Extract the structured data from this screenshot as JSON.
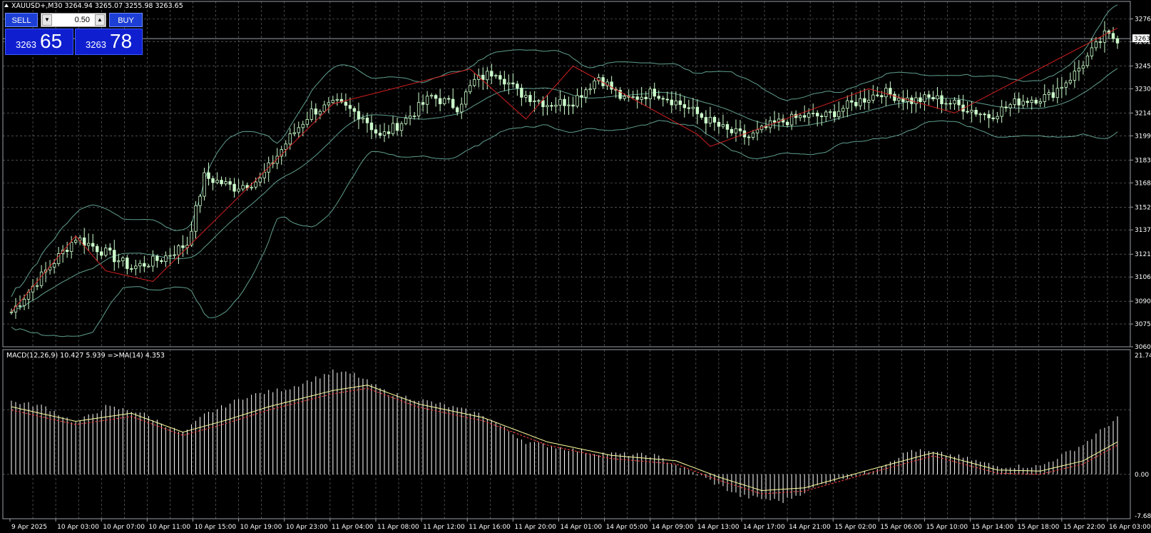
{
  "header": {
    "symbol_line": "XAUUSD+,M30  3264.94 3265.07 3255.98 3263.65"
  },
  "trade_panel": {
    "sell_label": "SELL",
    "buy_label": "BUY",
    "lot_value": "0.50",
    "sell_price_prefix": "3263",
    "sell_price_big": "65",
    "buy_price_prefix": "3263",
    "buy_price_big": "78"
  },
  "colors": {
    "background": "#000000",
    "grid": "#9aa0a6",
    "bull_candle": "#ccffcc",
    "bear_candle": "#ccffcc",
    "bands": "#5f9f8f",
    "zigzag": "#d42020",
    "macd_hist": "#ffffff",
    "macd_signal": "#ffffa0",
    "macd_ma": "#ff4040",
    "price_line": "#9aa0a6"
  },
  "price_axis": {
    "ticks": [
      "3276",
      "3261",
      "3245",
      "3230",
      "3214",
      "3199",
      "3183",
      "3168",
      "3152",
      "3137",
      "3121",
      "3106",
      "3090",
      "3075",
      "3060"
    ],
    "current_price": "3263"
  },
  "macd_panel": {
    "title": "MACD(12,26,9) 10.427 5.939  =>MA(14) 4.353",
    "ticks": [
      "21.74",
      "0.00",
      "-7.68"
    ]
  },
  "time_axis": {
    "labels": [
      "9 Apr 2025",
      "10 Apr 03:00",
      "10 Apr 07:00",
      "10 Apr 11:00",
      "10 Apr 15:00",
      "10 Apr 19:00",
      "10 Apr 23:00",
      "11 Apr 04:00",
      "11 Apr 08:00",
      "11 Apr 12:00",
      "11 Apr 16:00",
      "11 Apr 20:00",
      "14 Apr 01:00",
      "14 Apr 05:00",
      "14 Apr 09:00",
      "14 Apr 13:00",
      "14 Apr 17:00",
      "14 Apr 21:00",
      "15 Apr 02:00",
      "15 Apr 06:00",
      "15 Apr 10:00",
      "15 Apr 14:00",
      "15 Apr 18:00",
      "15 Apr 22:00",
      "16 Apr 03:00"
    ]
  },
  "chart_data": {
    "type": "candlestick",
    "symbol": "XAUUSD+",
    "timeframe": "M30",
    "ylim": [
      3060,
      3280
    ],
    "close_anchors": [
      [
        0,
        3083
      ],
      [
        8,
        3110
      ],
      [
        15,
        3132
      ],
      [
        22,
        3122
      ],
      [
        28,
        3112
      ],
      [
        35,
        3118
      ],
      [
        41,
        3128
      ],
      [
        45,
        3172
      ],
      [
        52,
        3165
      ],
      [
        58,
        3170
      ],
      [
        65,
        3198
      ],
      [
        70,
        3215
      ],
      [
        76,
        3220
      ],
      [
        82,
        3212
      ],
      [
        86,
        3198
      ],
      [
        92,
        3210
      ],
      [
        98,
        3225
      ],
      [
        104,
        3218
      ],
      [
        108,
        3235
      ],
      [
        113,
        3242
      ],
      [
        118,
        3228
      ],
      [
        125,
        3220
      ],
      [
        131,
        3222
      ],
      [
        137,
        3238
      ],
      [
        143,
        3222
      ],
      [
        150,
        3228
      ],
      [
        156,
        3220
      ],
      [
        162,
        3210
      ],
      [
        167,
        3202
      ],
      [
        172,
        3198
      ],
      [
        178,
        3207
      ],
      [
        185,
        3212
      ],
      [
        190,
        3212
      ],
      [
        196,
        3220
      ],
      [
        203,
        3228
      ],
      [
        210,
        3222
      ],
      [
        215,
        3224
      ],
      [
        222,
        3218
      ],
      [
        228,
        3212
      ],
      [
        235,
        3222
      ],
      [
        242,
        3225
      ],
      [
        248,
        3240
      ],
      [
        255,
        3265
      ],
      [
        258,
        3263
      ]
    ],
    "zigzag": [
      [
        0,
        3083
      ],
      [
        15,
        3133
      ],
      [
        22,
        3110
      ],
      [
        33,
        3103
      ],
      [
        75,
        3220
      ],
      [
        107,
        3243
      ],
      [
        120,
        3210
      ],
      [
        131,
        3245
      ],
      [
        160,
        3200
      ],
      [
        163,
        3192
      ],
      [
        200,
        3230
      ],
      [
        220,
        3214
      ],
      [
        258,
        3270
      ]
    ],
    "macd": {
      "ylim": [
        -7.68,
        21.74
      ],
      "histogram_anchors": [
        [
          0,
          13.5
        ],
        [
          8,
          12.5
        ],
        [
          15,
          9.5
        ],
        [
          22,
          12.5
        ],
        [
          30,
          11.5
        ],
        [
          40,
          7.5
        ],
        [
          45,
          11
        ],
        [
          55,
          14.5
        ],
        [
          65,
          16
        ],
        [
          75,
          19
        ],
        [
          80,
          18.5
        ],
        [
          88,
          15
        ],
        [
          100,
          13
        ],
        [
          110,
          11
        ],
        [
          120,
          6
        ],
        [
          135,
          4
        ],
        [
          150,
          3.5
        ],
        [
          160,
          0
        ],
        [
          170,
          -4
        ],
        [
          180,
          -5
        ],
        [
          190,
          -1.5
        ],
        [
          200,
          0.5
        ],
        [
          210,
          4.5
        ],
        [
          220,
          3.5
        ],
        [
          230,
          1.5
        ],
        [
          240,
          1.5
        ],
        [
          250,
          5.5
        ],
        [
          258,
          10.5
        ]
      ],
      "signal_anchors": [
        [
          0,
          12.5
        ],
        [
          15,
          9.8
        ],
        [
          28,
          11.3
        ],
        [
          40,
          7.8
        ],
        [
          50,
          10
        ],
        [
          60,
          12.5
        ],
        [
          75,
          15.5
        ],
        [
          83,
          16.5
        ],
        [
          95,
          13
        ],
        [
          110,
          10.5
        ],
        [
          125,
          6
        ],
        [
          140,
          3.5
        ],
        [
          155,
          2.5
        ],
        [
          165,
          -0.5
        ],
        [
          175,
          -3
        ],
        [
          185,
          -2.5
        ],
        [
          200,
          0.8
        ],
        [
          215,
          4
        ],
        [
          230,
          0.8
        ],
        [
          240,
          0.6
        ],
        [
          250,
          2.5
        ],
        [
          258,
          6
        ]
      ]
    }
  }
}
